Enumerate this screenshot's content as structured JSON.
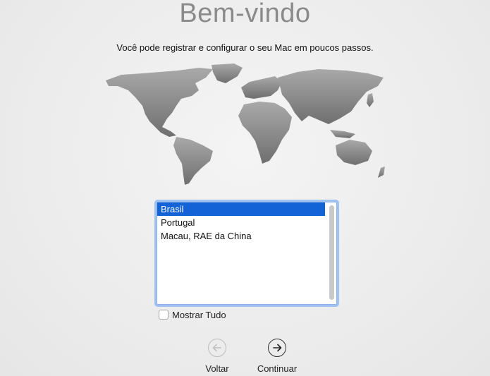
{
  "welcome": {
    "title": "Bem-vindo",
    "subtitle": "Você pode registrar e configurar o seu Mac em poucos passos."
  },
  "regions": {
    "items": [
      "Brasil",
      "Portugal",
      "Macau, RAE da China"
    ],
    "selected_index": 0
  },
  "show_all": {
    "label": "Mostrar Tudo",
    "checked": false
  },
  "navigation": {
    "back_label": "Voltar",
    "continue_label": "Continuar"
  },
  "colors": {
    "selection": "#1463d6",
    "focus_ring": "#9ec3f3",
    "map": "#8c8c8c"
  }
}
